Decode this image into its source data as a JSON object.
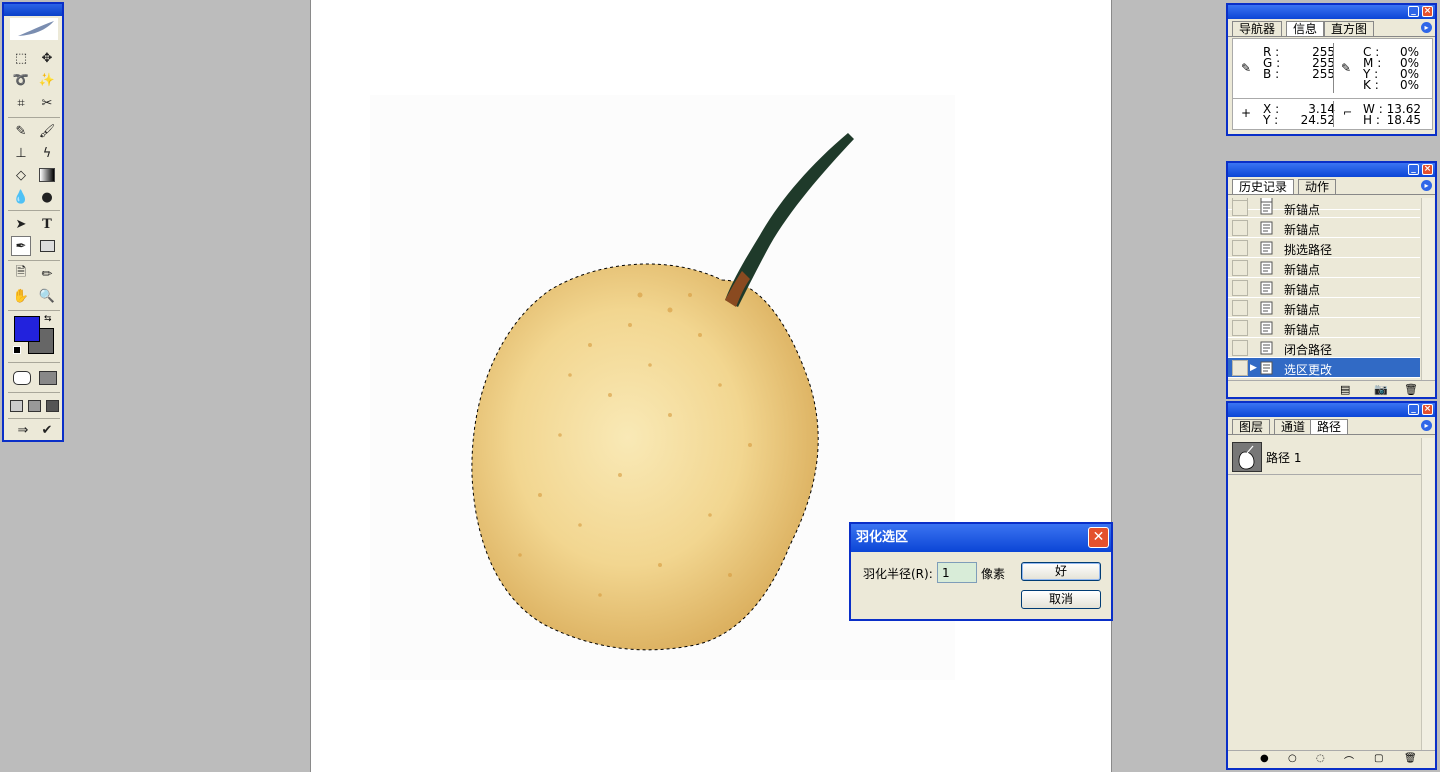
{
  "info_panel": {
    "tabs": [
      "导航器",
      "信息",
      "直方图"
    ],
    "selected_tab": 1,
    "rgb": {
      "labels": [
        "R",
        "G",
        "B"
      ],
      "values": [
        "255",
        "255",
        "255"
      ]
    },
    "cmyk": {
      "labels": [
        "C",
        "M",
        "Y",
        "K"
      ],
      "values": [
        "0%",
        "0%",
        "0%",
        "0%"
      ]
    },
    "xy": {
      "labels": [
        "X",
        "Y"
      ],
      "values": [
        "3.14",
        "24.52"
      ]
    },
    "wh": {
      "labels": [
        "W",
        "H"
      ],
      "values": [
        "13.62",
        "18.45"
      ]
    },
    "sep": ":"
  },
  "history_panel": {
    "tabs": [
      "历史记录",
      "动作"
    ],
    "selected_tab": 0,
    "items": [
      "新锚点",
      "新锚点",
      "挑选路径",
      "新锚点",
      "新锚点",
      "新锚点",
      "新锚点",
      "闭合路径",
      "选区更改"
    ],
    "selected_index": 8
  },
  "paths_panel": {
    "tabs": [
      "图层",
      "通道",
      "路径"
    ],
    "selected_tab": 2,
    "paths": [
      {
        "name": "路径 1"
      }
    ]
  },
  "toolbox": {
    "foreground_color": "#2222dd",
    "background_color": "#666666"
  },
  "dialog": {
    "title": "羽化选区",
    "label": "羽化半径(R):",
    "value": "1",
    "unit": "像素",
    "ok": "好",
    "cancel": "取消"
  },
  "colors": {
    "accent": "#0a2fc8",
    "selection": "#316ac5"
  }
}
